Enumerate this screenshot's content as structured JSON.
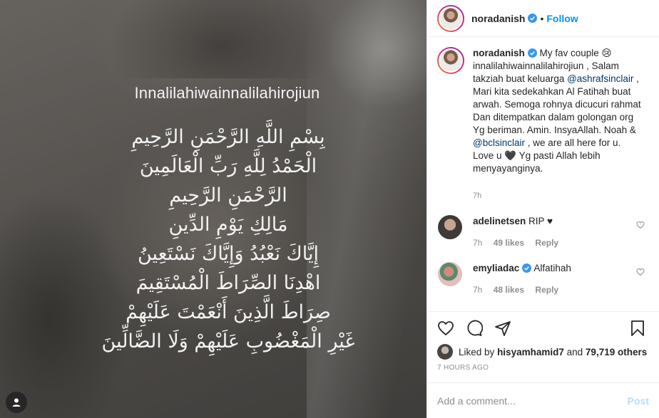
{
  "story": {
    "title": "Innalilahiwainnalilahirojiun",
    "arabic_lines": [
      "بِسْمِ اللَّهِ الرَّحْمَنِ الرَّحِيمِ",
      "الْحَمْدُ لِلَّهِ رَبِّ الْعَالَمِينَ",
      "الرَّحْمَنِ الرَّحِيمِ",
      "مَالِكِ يَوْمِ الدِّينِ",
      "إِيَّاكَ نَعْبُدُ وَإِيَّاكَ نَسْتَعِينُ",
      "اهْدِنَا الصِّرَاطَ الْمُسْتَقِيمَ",
      "صِرَاطَ الَّذِينَ أَنْعَمْتَ عَلَيْهِمْ",
      "غَيْرِ الْمَغْضُوبِ عَلَيْهِمْ وَلَا الضَّالِّينَ"
    ]
  },
  "header": {
    "username": "noradanish",
    "separator": "•",
    "follow_label": "Follow"
  },
  "caption": {
    "username": "noradanish",
    "text_1": " My fav couple 😢 innalilahiwainnalilahirojiun , Salam takziah buat keluarga ",
    "mention_1": "@ashrafsinclair",
    "text_2": " , Mari kita sedekahkan Al Fatihah buat arwah. Semoga rohnya dicucuri rahmat Dan ditempatkan dalam golongan org Yg beriman. Amin. InsyaAllah. Noah & ",
    "mention_2": "@bclsinclair",
    "text_3": " , we are all here for u. Love u 🖤 Yg pasti Allah lebih menyayanginya.",
    "time": "7h"
  },
  "comments": [
    {
      "username": "adelinetsen",
      "text": "RIP ♥",
      "time": "7h",
      "likes": "49 likes",
      "reply": "Reply"
    },
    {
      "username": "emyliadac",
      "text": "Alfatihah",
      "time": "7h",
      "likes": "48 likes",
      "reply": "Reply"
    }
  ],
  "likes": {
    "prefix": "Liked by ",
    "user": "hisyamhamid7",
    "middle": " and ",
    "others": "79,719 others"
  },
  "posted": "7 HOURS AGO",
  "add_comment": {
    "placeholder": "Add a comment...",
    "post_label": "Post"
  },
  "colors": {
    "accent": "#0095f6",
    "text": "#262626",
    "muted": "#8e8e8e",
    "post_disabled": "#b2dffc"
  }
}
